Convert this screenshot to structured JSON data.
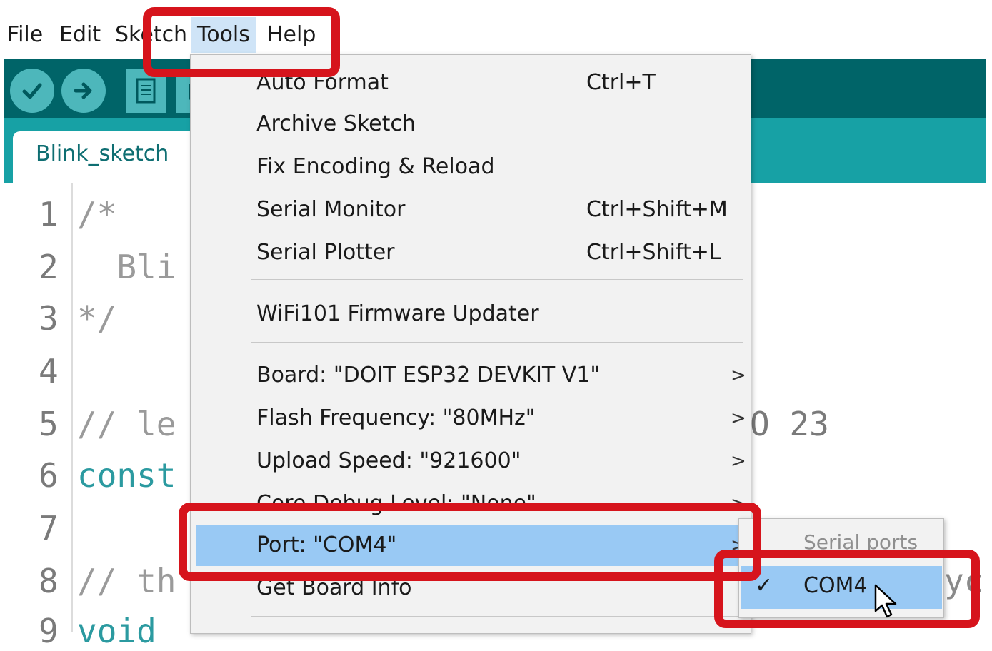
{
  "menubar": {
    "items": [
      {
        "id": "file",
        "label": "File"
      },
      {
        "id": "edit",
        "label": "Edit"
      },
      {
        "id": "sketch",
        "label": "Sketch"
      },
      {
        "id": "tools",
        "label": "Tools"
      },
      {
        "id": "help",
        "label": "Help"
      }
    ]
  },
  "toolbar": {
    "buttons": [
      {
        "name": "verify-button",
        "icon": "checkmark-icon"
      },
      {
        "name": "upload-button",
        "icon": "arrow-right-icon"
      },
      {
        "name": "new-button",
        "icon": "document-icon"
      },
      {
        "name": "open-button",
        "icon": "open-icon"
      }
    ]
  },
  "tabs": {
    "active_label": "Blink_sketch"
  },
  "editor": {
    "lines": [
      {
        "n": "1",
        "text": "/*"
      },
      {
        "n": "2",
        "text": "  Bli"
      },
      {
        "n": "3",
        "text": "*/"
      },
      {
        "n": "4",
        "text": ""
      },
      {
        "n": "5",
        "text": "// le"
      },
      {
        "n": "6",
        "text": "const"
      },
      {
        "n": "7",
        "text": ""
      },
      {
        "n": "8",
        "text": "// th"
      },
      {
        "n": "9",
        "text": "void"
      }
    ],
    "line5_tail": "O 23",
    "line8_tail": "yc"
  },
  "tools_menu": {
    "items": [
      {
        "label": "Auto Format",
        "shortcut": "Ctrl+T"
      },
      {
        "label": "Archive Sketch",
        "shortcut": ""
      },
      {
        "label": "Fix Encoding & Reload",
        "shortcut": ""
      },
      {
        "label": "Serial Monitor",
        "shortcut": "Ctrl+Shift+M"
      },
      {
        "label": "Serial Plotter",
        "shortcut": "Ctrl+Shift+L"
      },
      {
        "label": "WiFi101 Firmware Updater",
        "shortcut": ""
      },
      {
        "label": "Board: \"DOIT ESP32 DEVKIT V1\"",
        "arrow": ">"
      },
      {
        "label": "Flash Frequency: \"80MHz\"",
        "arrow": ">"
      },
      {
        "label": "Upload Speed: \"921600\"",
        "arrow": ">"
      },
      {
        "label": "Core Debug Level: \"None\"",
        "arrow": ">"
      },
      {
        "label": "Port: \"COM4\"",
        "arrow": ">"
      },
      {
        "label": "Get Board Info"
      }
    ]
  },
  "port_submenu": {
    "header": "Serial ports",
    "items": [
      {
        "label": "COM4",
        "checked": true,
        "check_glyph": "✓"
      }
    ]
  },
  "colors": {
    "highlight": "#d6141c",
    "toolbar": "#006468",
    "tabbar": "#17a1a5",
    "selection": "#99c9f4"
  }
}
